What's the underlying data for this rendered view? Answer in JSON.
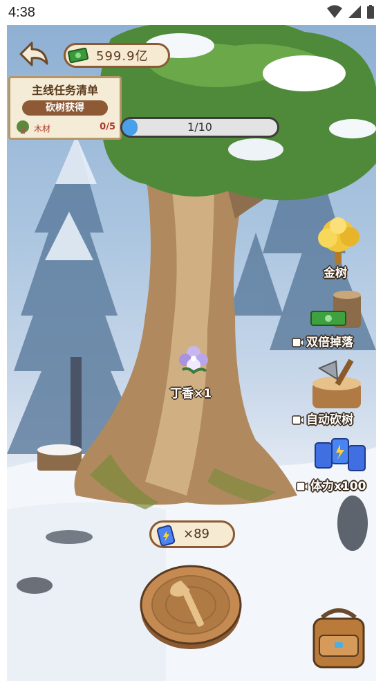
{
  "status_bar": {
    "time": "4:38"
  },
  "currency": {
    "amount": "599.9亿",
    "icon": "cash-icon"
  },
  "quest": {
    "title": "主线任务清单",
    "subtitle": "砍树获得",
    "item_label": "木材",
    "item_count": "0/5"
  },
  "progress": {
    "text": "1/10",
    "fraction": 0.1
  },
  "side_buttons": {
    "gold_tree": "金树",
    "double_drop": "双倍掉落",
    "auto_chop": "自动砍树",
    "stamina": "体力x100"
  },
  "drop": {
    "label": "丁香×1"
  },
  "stamina_counter": {
    "value": "×89"
  },
  "colors": {
    "progress_fill": "#48a0e8",
    "panel_bg": "#f5ecd7",
    "panel_border": "#8a5a33"
  }
}
